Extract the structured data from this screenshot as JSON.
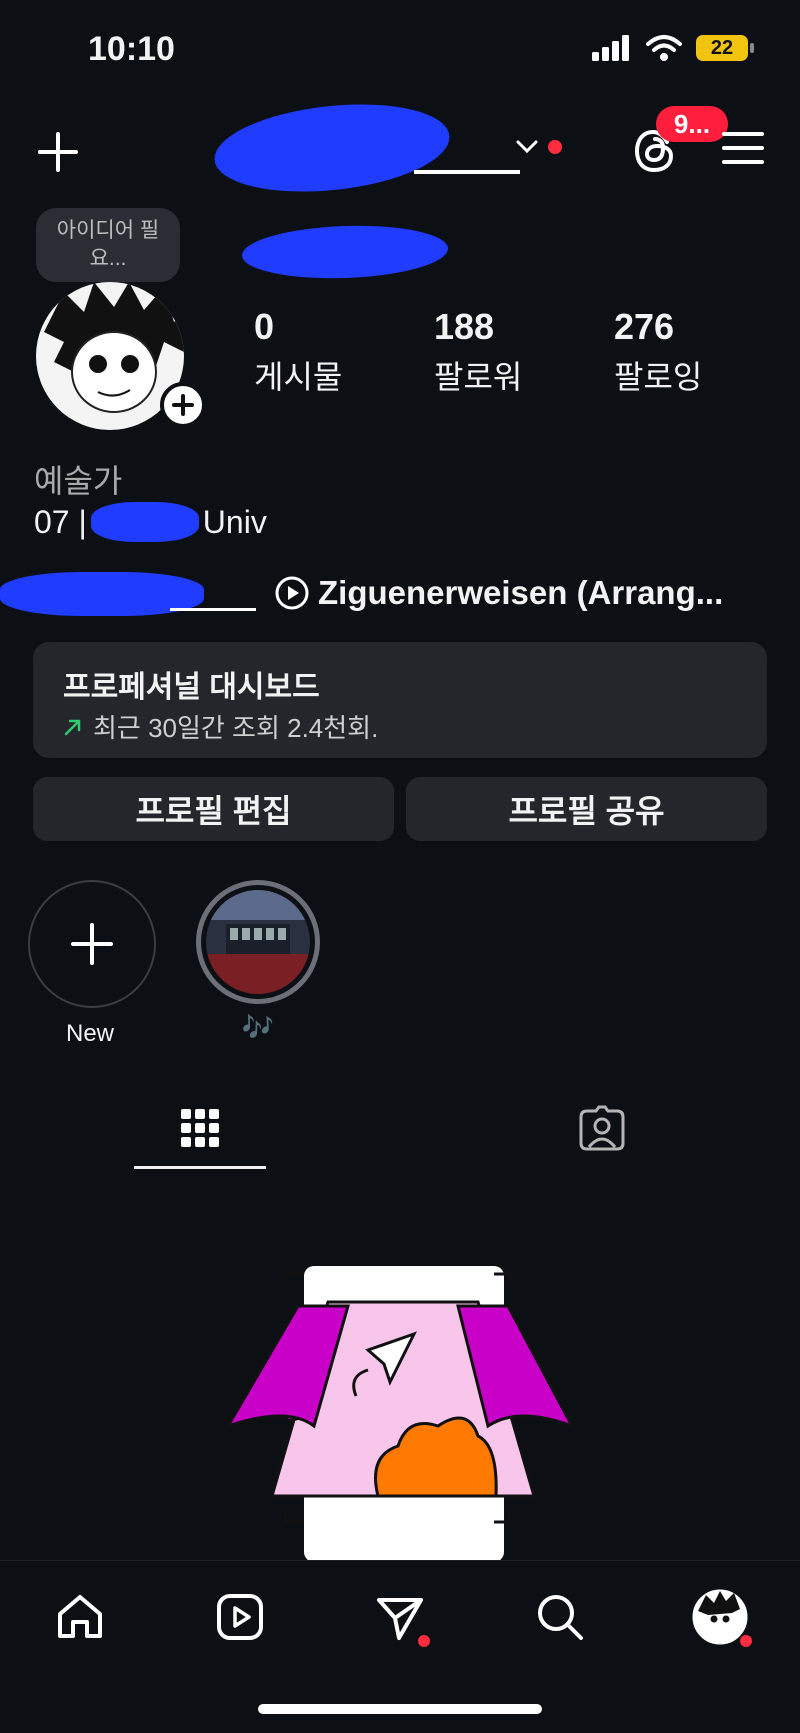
{
  "status_bar": {
    "time": "10:10",
    "battery": "22"
  },
  "header": {
    "notification_badge": "9..."
  },
  "profile": {
    "note_bubble": "아이디어 필요...",
    "stats": [
      {
        "value": "0",
        "label": "게시물"
      },
      {
        "value": "188",
        "label": "팔로워"
      },
      {
        "value": "276",
        "label": "팔로잉"
      }
    ],
    "category": "예술가",
    "bio_line_prefix": "07 |",
    "bio_line_suffix": "Univ",
    "music_track": "Ziguenerweisen (Arrang..."
  },
  "dashboard": {
    "title": "프로페셔널 대시보드",
    "subtitle": "최근 30일간 조회 2.4천회."
  },
  "actions": {
    "edit_profile": "프로필 편집",
    "share_profile": "프로필 공유"
  },
  "highlights": [
    {
      "label": "New"
    },
    {
      "label": "🎶"
    }
  ],
  "colors": {
    "background": "#0c0f14",
    "accent_red": "#ff2d3d",
    "redaction_blue": "#1f3cff",
    "illustration_magenta": "#c800c8",
    "illustration_orange": "#ff7a00"
  }
}
